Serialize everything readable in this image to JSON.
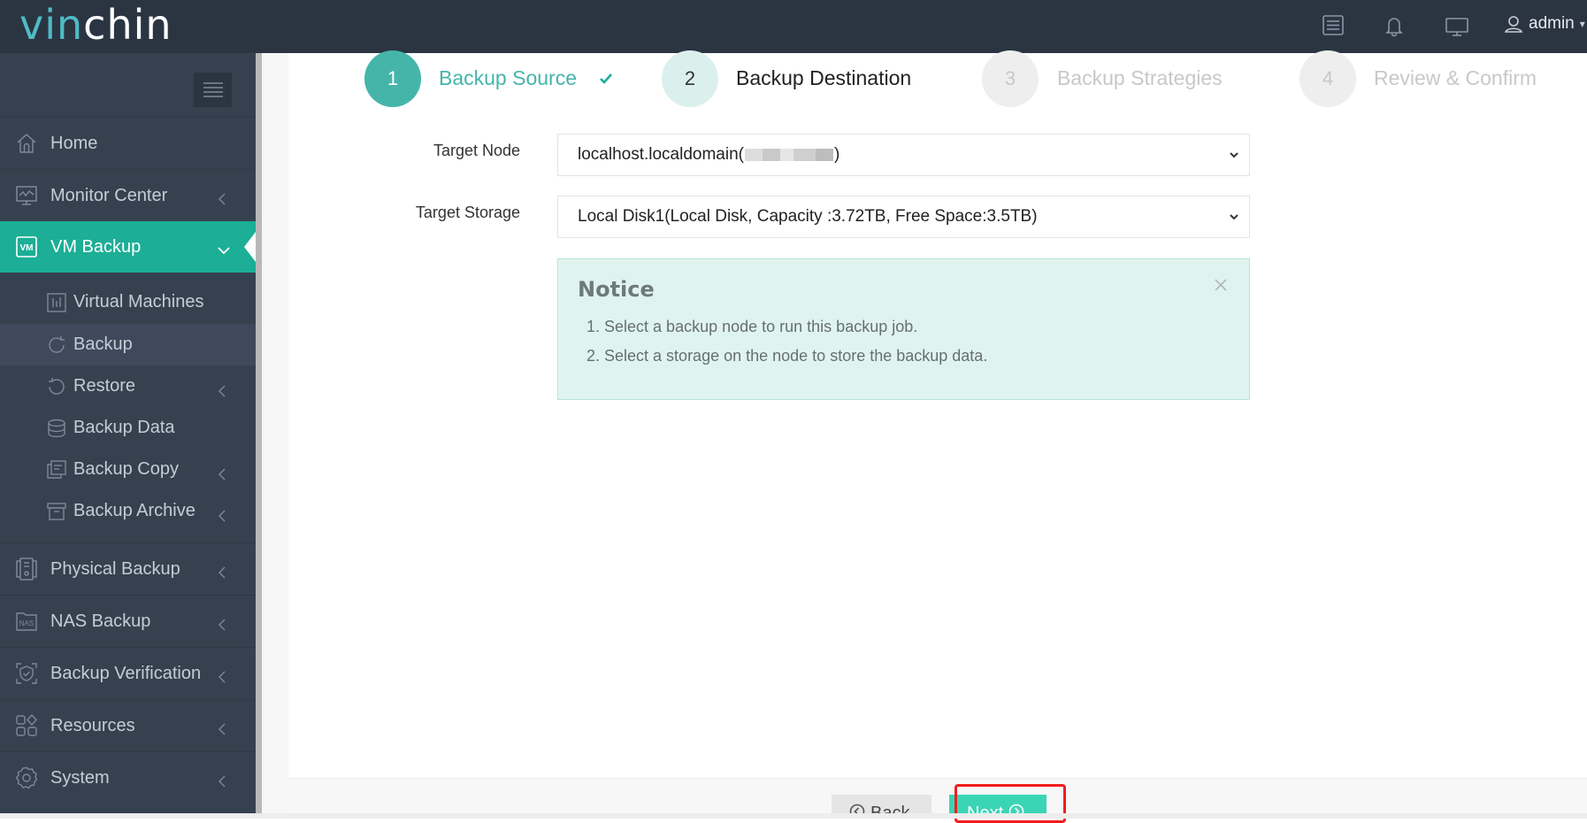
{
  "app": {
    "logo_part1": "vin",
    "logo_part2": "chin",
    "user": "admin"
  },
  "header_icons": [
    "task-list-icon",
    "bell-icon",
    "monitor-icon",
    "user-icon"
  ],
  "sidebar": {
    "items": [
      {
        "label": "Home",
        "icon": "home-icon",
        "has_chevron": false
      },
      {
        "label": "Monitor Center",
        "icon": "monitor-chart-icon",
        "has_chevron": true
      },
      {
        "label": "VM Backup",
        "icon": "vm-icon",
        "has_chevron": true,
        "active": true,
        "expanded": true
      },
      {
        "label": "Physical Backup",
        "icon": "server-icon",
        "has_chevron": true
      },
      {
        "label": "NAS Backup",
        "icon": "nas-icon",
        "has_chevron": true
      },
      {
        "label": "Backup Verification",
        "icon": "shield-check-icon",
        "has_chevron": true
      },
      {
        "label": "Resources",
        "icon": "resources-icon",
        "has_chevron": true
      },
      {
        "label": "System",
        "icon": "gear-icon",
        "has_chevron": true
      }
    ],
    "vm_backup_sub": [
      {
        "label": "Virtual Machines",
        "icon": "vm-list-icon",
        "has_chevron": false
      },
      {
        "label": "Backup",
        "icon": "refresh-icon",
        "has_chevron": false,
        "current": true
      },
      {
        "label": "Restore",
        "icon": "restore-icon",
        "has_chevron": true
      },
      {
        "label": "Backup Data",
        "icon": "database-icon",
        "has_chevron": false
      },
      {
        "label": "Backup Copy",
        "icon": "copy-icon",
        "has_chevron": true
      },
      {
        "label": "Backup Archive",
        "icon": "archive-icon",
        "has_chevron": true
      }
    ]
  },
  "wizard": {
    "steps": [
      {
        "number": "1",
        "label": "Backup Source",
        "state": "done"
      },
      {
        "number": "2",
        "label": "Backup Destination",
        "state": "current"
      },
      {
        "number": "3",
        "label": "Backup Strategies",
        "state": "todo"
      },
      {
        "number": "4",
        "label": "Review & Confirm",
        "state": "todo"
      }
    ]
  },
  "form": {
    "target_node_label": "Target Node",
    "target_node_value_prefix": "localhost.localdomain(",
    "target_node_value_suffix": ")",
    "target_storage_label": "Target Storage",
    "target_storage_value": "Local Disk1(Local Disk, Capacity :3.72TB, Free Space:3.5TB)"
  },
  "notice": {
    "title": "Notice",
    "lines": [
      "1. Select a backup node to run this backup job.",
      "2. Select a storage on the node to store the backup data."
    ]
  },
  "footer": {
    "back_label": "Back",
    "next_label": "Next"
  },
  "colors": {
    "header_bg": "#2b3542",
    "sidebar_bg": "#364150",
    "accent": "#1cae96",
    "step_done": "#45b5aa",
    "next_button": "#3ad5b5",
    "highlight": "#f21d1d"
  }
}
